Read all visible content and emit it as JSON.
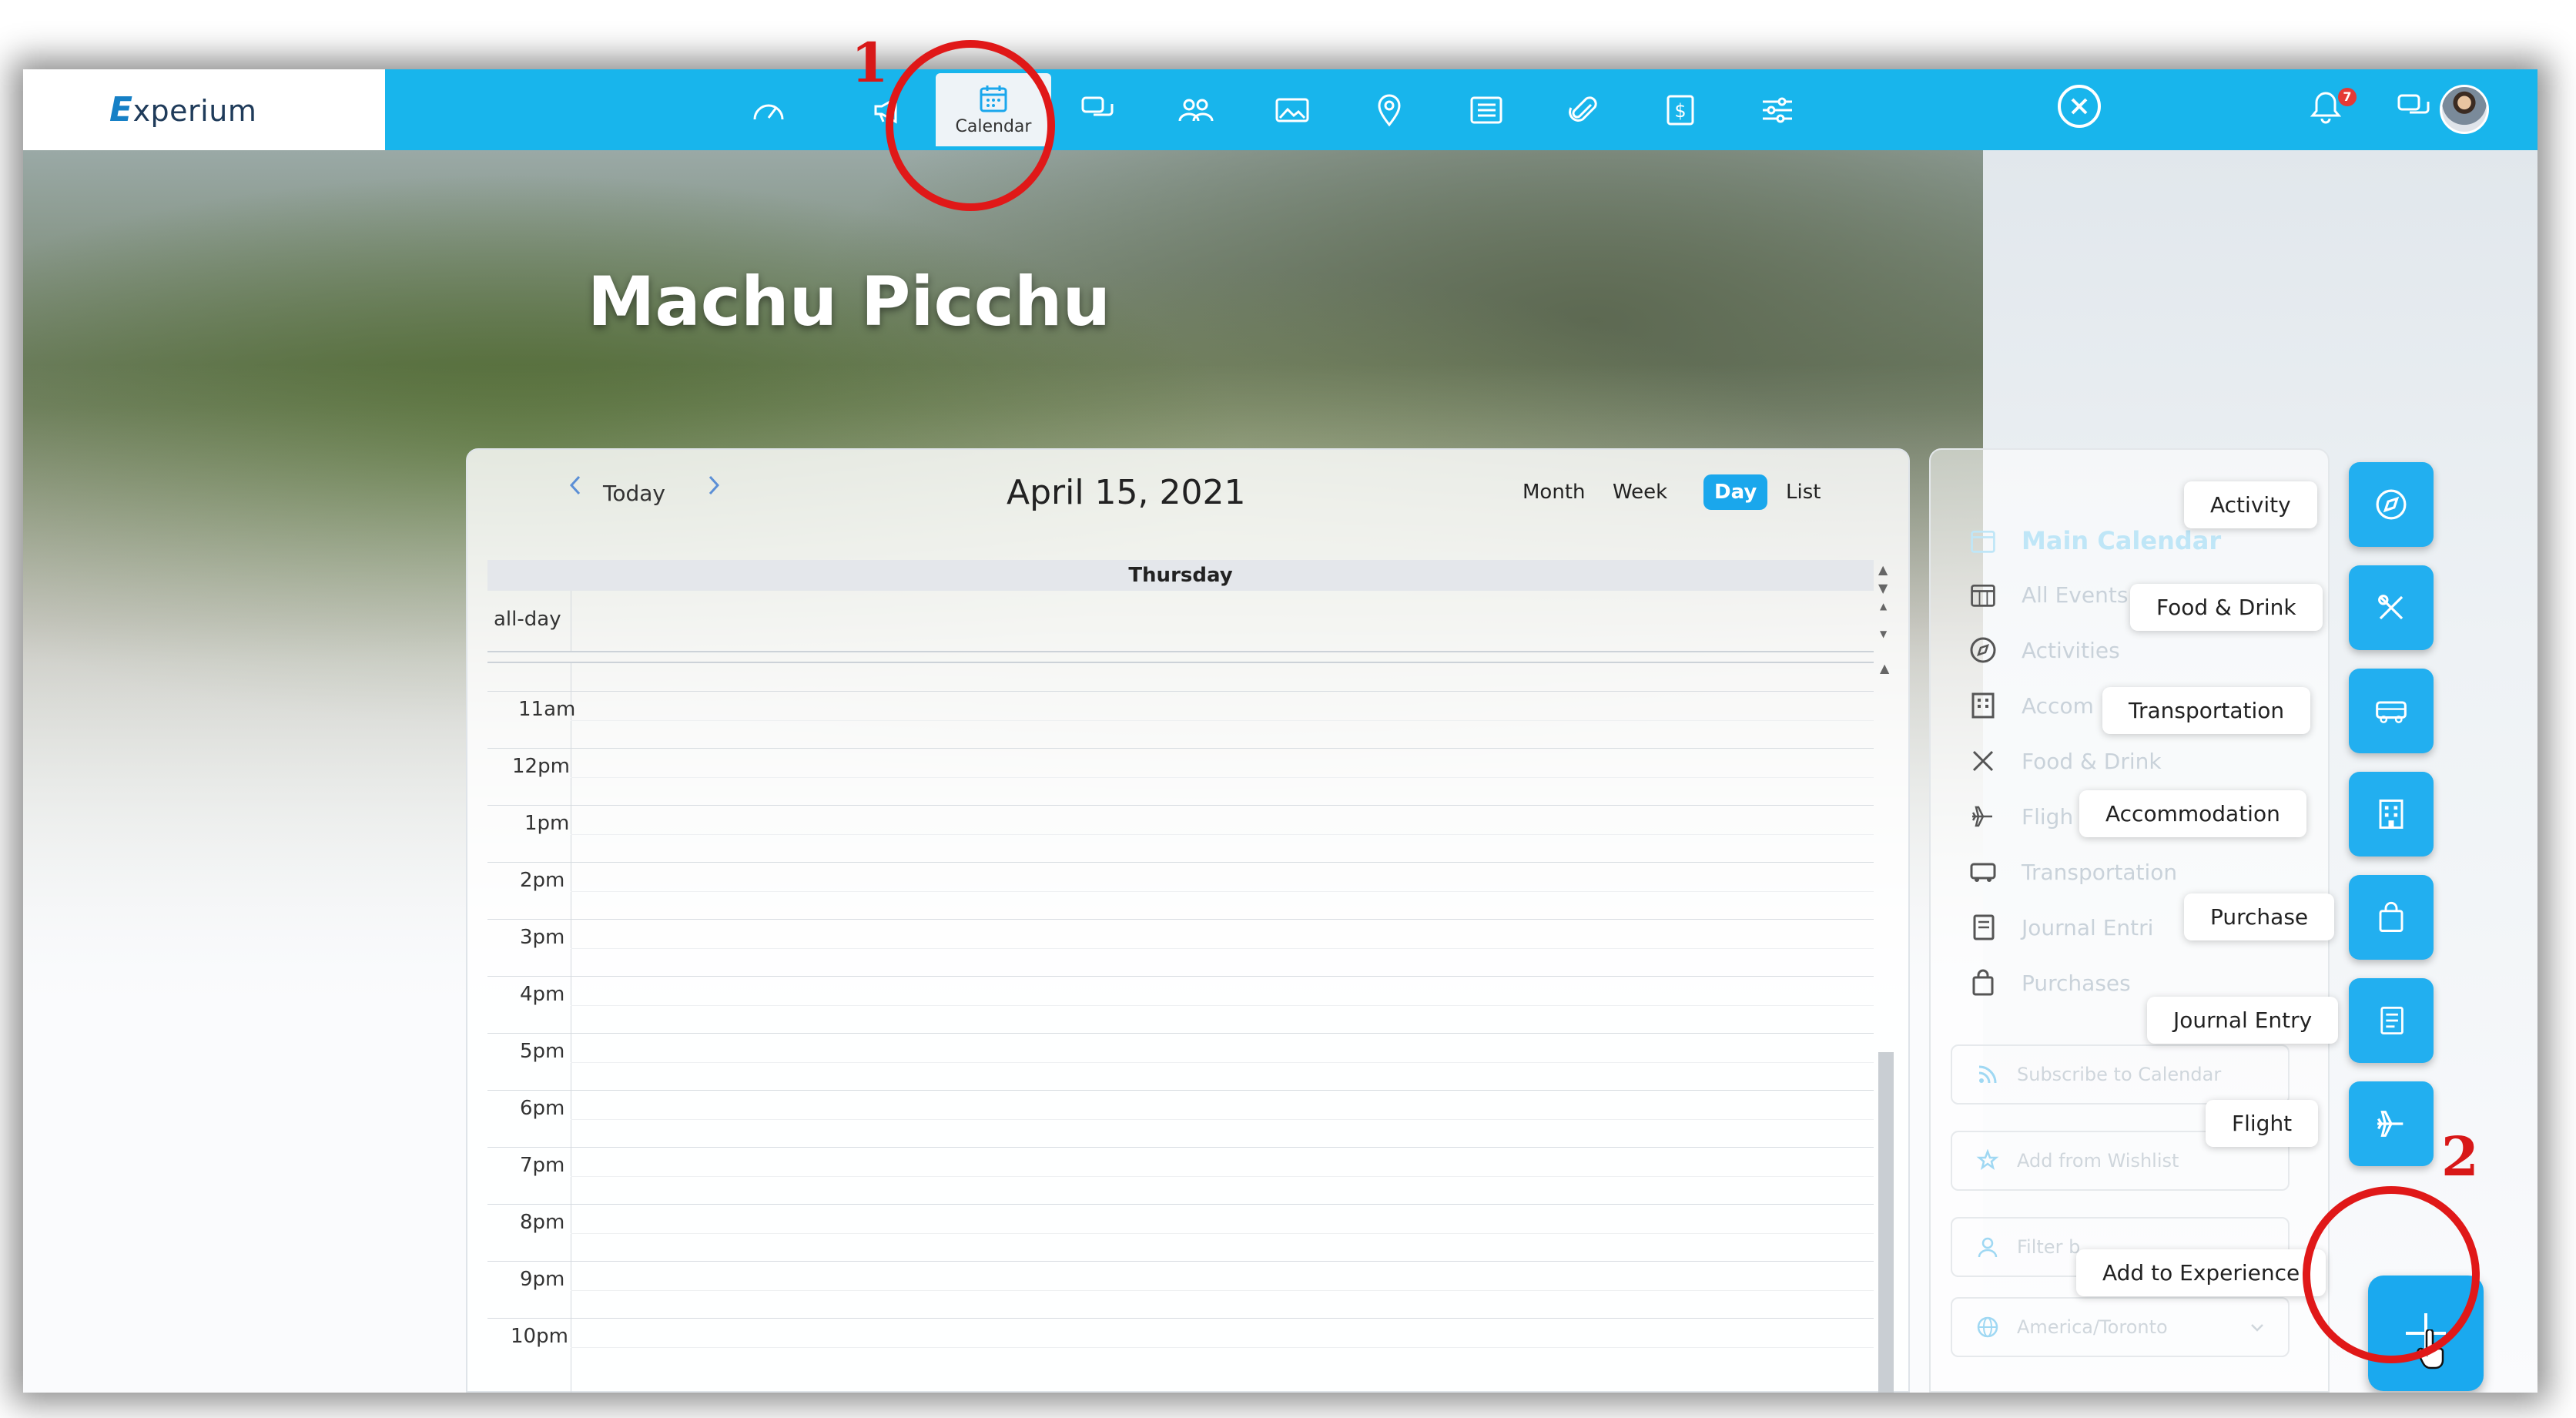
{
  "app": {
    "logo_mark": "E",
    "logo_text": "xperium"
  },
  "nav": {
    "items": [
      {
        "icon": "dashboard-gauge-icon"
      },
      {
        "icon": "megaphone-icon"
      },
      {
        "icon": "calendar-icon",
        "label": "Calendar",
        "active": true
      },
      {
        "icon": "chat-bubbles-icon"
      },
      {
        "icon": "people-icon"
      },
      {
        "icon": "photos-icon"
      },
      {
        "icon": "map-pin-icon"
      },
      {
        "icon": "list-icon"
      },
      {
        "icon": "paperclip-icon"
      },
      {
        "icon": "dollar-document-icon"
      },
      {
        "icon": "sliders-icon"
      }
    ],
    "notification_count": "7"
  },
  "hero": {
    "title": "Machu Picchu"
  },
  "calendar": {
    "today_label": "Today",
    "date_title": "April 15, 2021",
    "views": [
      "Month",
      "Week",
      "Day",
      "List"
    ],
    "active_view": "Day",
    "day_header": "Thursday",
    "allday_label": "all-day",
    "hours": [
      "11am",
      "12pm",
      "1pm",
      "2pm",
      "3pm",
      "4pm",
      "5pm",
      "6pm",
      "7pm",
      "8pm",
      "9pm",
      "10pm"
    ]
  },
  "side_panel": {
    "items": [
      {
        "label": "Main Calendar",
        "icon": "calendar-icon"
      },
      {
        "label": "All Events",
        "icon": "calendar-grid-icon"
      },
      {
        "label": "Activities",
        "icon": "compass-icon"
      },
      {
        "label": "Accom",
        "icon": "building-icon"
      },
      {
        "label": "Food & Drink",
        "icon": "utensils-icon"
      },
      {
        "label": "Fligh",
        "icon": "plane-icon"
      },
      {
        "label": "Transportation",
        "icon": "bus-icon"
      },
      {
        "label": "Journal Entri",
        "icon": "journal-icon"
      },
      {
        "label": "Purchases",
        "icon": "shopping-bag-icon"
      }
    ],
    "subscribe_label": "Subscribe to Calendar",
    "wishlist_label": "Add from Wishlist",
    "filter_label": "Filter b",
    "timezone_label": "America/Toronto"
  },
  "fab_menu": {
    "items": [
      {
        "label": "Activity",
        "icon": "compass-icon"
      },
      {
        "label": "Food & Drink",
        "icon": "utensils-icon"
      },
      {
        "label": "Transportation",
        "icon": "bus-icon"
      },
      {
        "label": "Accommodation",
        "icon": "building-icon"
      },
      {
        "label": "Purchase",
        "icon": "shopping-bag-icon"
      },
      {
        "label": "Journal Entry",
        "icon": "journal-icon"
      },
      {
        "label": "Flight",
        "icon": "plane-icon"
      }
    ],
    "main_label": "Add to Experience"
  },
  "annotations": {
    "step1": "1",
    "step2": "2",
    "color": "#e01818"
  },
  "colors": {
    "accent": "#18b5ec",
    "fab": "#22aff0"
  }
}
